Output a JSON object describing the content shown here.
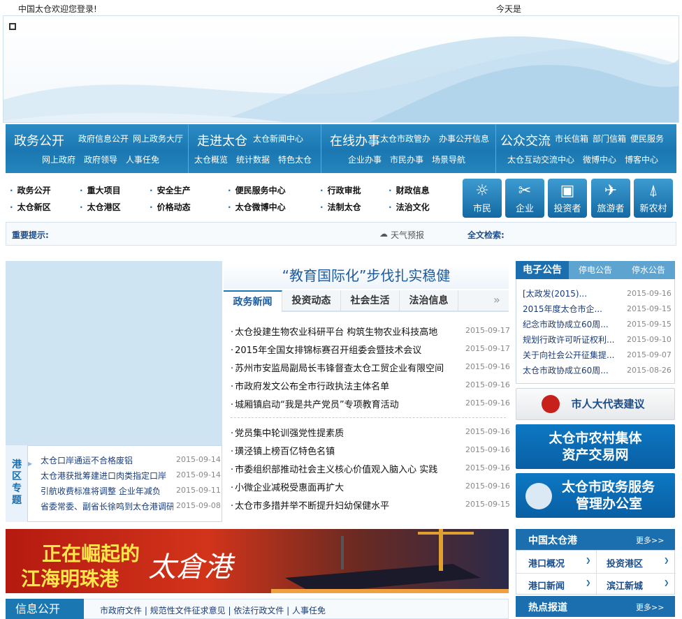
{
  "top": {
    "welcome": "中国太仓欢迎您登录!",
    "today": "今天是"
  },
  "nav": [
    {
      "title": "政务公开",
      "links1": [
        "政府信息公开",
        "网上政务大厅"
      ],
      "links2": [
        "网上政府",
        "政府领导",
        "人事任免"
      ]
    },
    {
      "title": "走进太仓",
      "links1": [
        "太仓新闻中心"
      ],
      "links2": [
        "太仓概览",
        "统计数据",
        "特色太仓"
      ]
    },
    {
      "title": "在线办事",
      "links1": [
        "太仓市政管办",
        "办事公开信息"
      ],
      "links2": [
        "企业办事",
        "市民办事",
        "场景导航"
      ]
    },
    {
      "title": "公众交流",
      "links1": [
        "市长信箱",
        "部门信箱",
        "便民服务"
      ],
      "links2": [
        "太仓互动交流中心",
        "微博中心",
        "博客中心"
      ]
    }
  ],
  "quicklinks": [
    "政务公开",
    "重大项目",
    "安全生产",
    "便民服务中心",
    "行政审批",
    "财政信息",
    "太仓新区",
    "太仓港区",
    "价格动态",
    "太仓微博中心",
    "法制太仓",
    "法治文化"
  ],
  "audience": [
    {
      "label": "市民",
      "icon": "sun-icon",
      "glyph": "☼"
    },
    {
      "label": "企业",
      "icon": "tools-icon",
      "glyph": "✂"
    },
    {
      "label": "投资者",
      "icon": "wallet-icon",
      "glyph": "▣"
    },
    {
      "label": "旅游者",
      "icon": "plane-icon",
      "glyph": "✈"
    },
    {
      "label": "新农村",
      "icon": "tower-icon",
      "glyph": "⍋"
    }
  ],
  "notice": {
    "label": "重要提示:",
    "weather": "天气预报",
    "search": "全文检索:"
  },
  "port": {
    "tag": "港区专题",
    "items": [
      {
        "t": "太仓口岸通运不合格废铝",
        "d": "2015-09-14"
      },
      {
        "t": "太仓港获批筹建进口肉类指定口岸",
        "d": "2015-09-14"
      },
      {
        "t": "引航收费标准将调整 企业年减负",
        "d": "2015-09-11"
      },
      {
        "t": "省委常委、副省长徐鸣到太仓港调研",
        "d": "2015-09-08"
      }
    ]
  },
  "headline": "“教育国际化”步伐扎实稳健",
  "tabs": [
    "政务新闻",
    "投资动态",
    "社会生活",
    "法治信息"
  ],
  "news1": [
    {
      "t": "太仓投建生物农业科研平台 构筑生物农业科技高地",
      "d": "2015-09-17"
    },
    {
      "t": "2015年全国女排锦标赛召开组委会暨技术会议",
      "d": "2015-09-17"
    },
    {
      "t": "苏州市安监局副局长韦锋督查太仓工贸企业有限空间",
      "d": "2015-09-16"
    },
    {
      "t": "市政府发文公布全市行政执法主体名单",
      "d": "2015-09-16"
    },
    {
      "t": "城厢镇启动“我是共产党员”专项教育活动",
      "d": "2015-09-16"
    }
  ],
  "news2": [
    {
      "t": "党员集中轮训强党性提素质",
      "d": "2015-09-16"
    },
    {
      "t": "璜泾镇上榜百亿特色名镇",
      "d": "2015-09-16"
    },
    {
      "t": "市委组织部推动社会主义核心价值观入脑入心 实践",
      "d": "2015-09-16"
    },
    {
      "t": "小微企业减税受惠面再扩大",
      "d": "2015-09-16"
    },
    {
      "t": "太仓市多措并举不断提升妇幼保健水平",
      "d": "2015-09-15"
    }
  ],
  "egov": {
    "tabs": [
      "电子公告",
      "停电公告",
      "停水公告"
    ],
    "items": [
      {
        "t": "[太政发(2015)...",
        "d": "2015-09-16"
      },
      {
        "t": "2015年度太仓市企...",
        "d": "2015-09-15"
      },
      {
        "t": "纪念市政协成立60周...",
        "d": "2015-09-15"
      },
      {
        "t": "规划行政许可听证权利...",
        "d": "2015-09-10"
      },
      {
        "t": "关于向社会公开征集提...",
        "d": "2015-09-07"
      },
      {
        "t": "太仓市政协成立60周...",
        "d": "2015-08-26"
      }
    ]
  },
  "rbtns": {
    "rd": "市人大代表建议",
    "farm1": "太仓市农村集体",
    "farm2": "资产交易网",
    "gov1": "太仓市政务服务",
    "gov2": "管理办公室"
  },
  "portbanner": {
    "l1": "正在崛起的",
    "l2": "江海明珠港",
    "r": "太倉港"
  },
  "info": {
    "title": "信息公开",
    "links": "市政府文件 | 规范性文件征求意见 | 依法行政文件 | 人事任免"
  },
  "tcport": {
    "title": "中国太仓港",
    "more": "更多>>",
    "cells": [
      "港口概况",
      "投资港区",
      "港口新闻",
      "滨江新城"
    ]
  },
  "hot": {
    "title": "热点报道",
    "more": "更多>>"
  },
  "colors": {
    "nav": "#1b77b1",
    "link": "#1a3c7a"
  }
}
